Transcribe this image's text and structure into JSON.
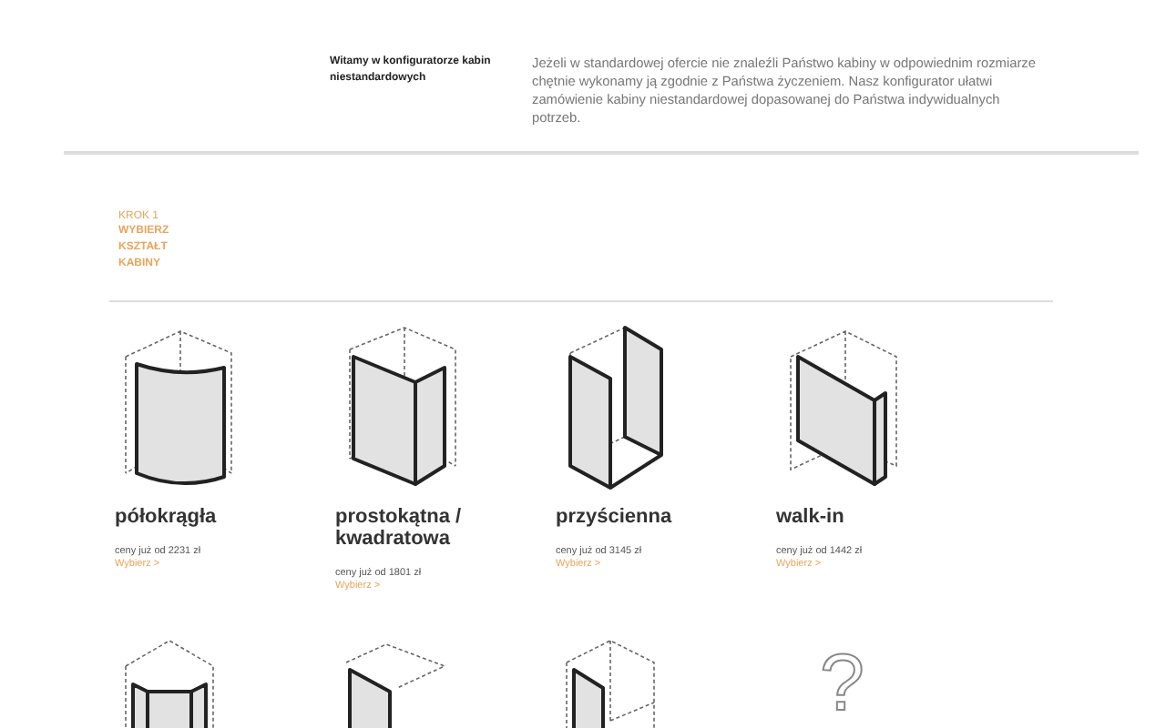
{
  "intro": {
    "heading": "Witamy w konfiguratorze kabin niestandardowych",
    "text": "Jeżeli w standardowej ofercie nie znaleźli Państwo kabiny w odpowiednim rozmiarze chętnie wykonamy ją zgodnie z Państwa życzeniem. Nasz konfigurator ułatwi zamówienie kabiny niestandardowej dopasowanej do Państwa indywidualnych potrzeb."
  },
  "step": {
    "number": "KROK 1",
    "title": "WYBIERZ KSZTAŁT KABINY"
  },
  "shapes": [
    {
      "kind": "quarter-round",
      "title": "półokrągła",
      "price": "ceny już od 2231 zł",
      "link": "Wybierz >"
    },
    {
      "kind": "rectangular",
      "title": "prostokątna / kwadratowa",
      "price": "ceny już od 1801 zł",
      "link": "Wybierz >"
    },
    {
      "kind": "wall",
      "title": "przyścienna",
      "price": "ceny już od 3145 zł",
      "link": "Wybierz >"
    },
    {
      "kind": "walk-in",
      "title": "walk-in",
      "price": "ceny już od 1442 zł",
      "link": "Wybierz >"
    },
    {
      "kind": "pentagon"
    },
    {
      "kind": "corner-panel"
    },
    {
      "kind": "wall-panel"
    },
    {
      "kind": "unknown",
      "symbol": "?"
    }
  ]
}
